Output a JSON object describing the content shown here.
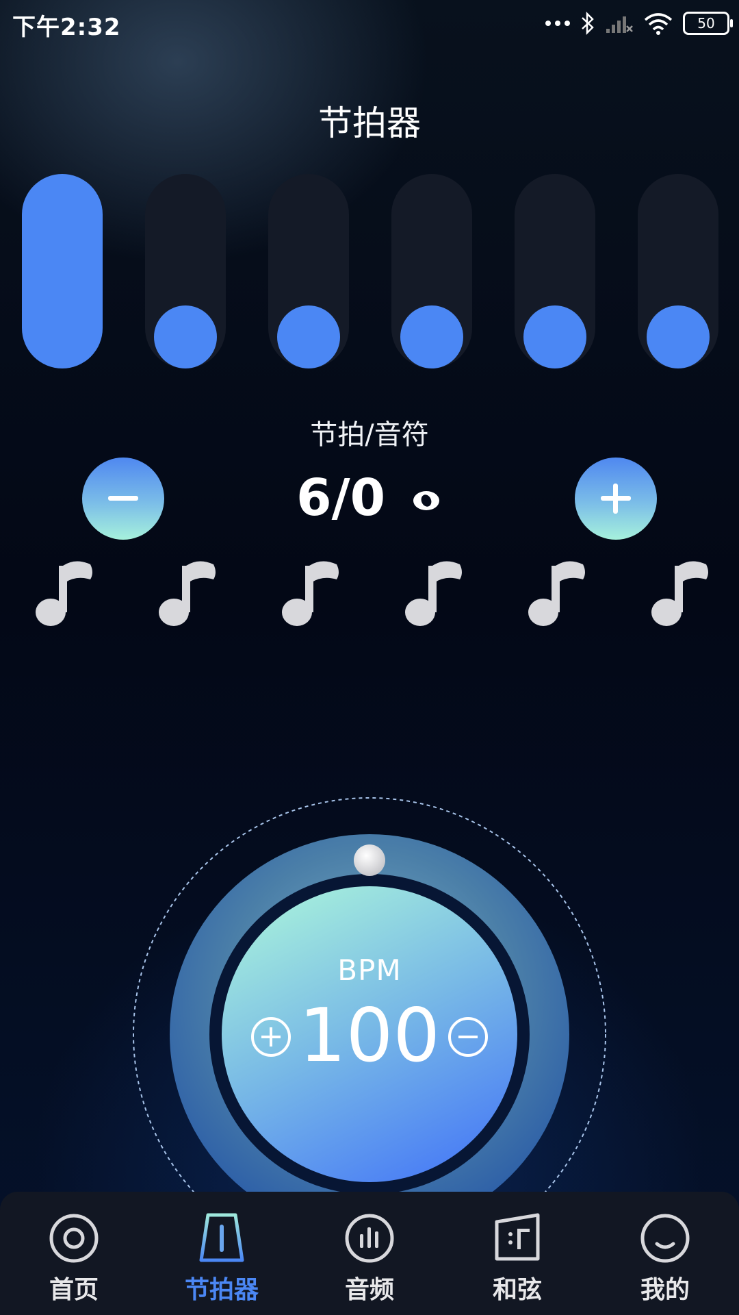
{
  "status_bar": {
    "time": "下午2:32",
    "battery": "50"
  },
  "page": {
    "title": "节拍器"
  },
  "beats": {
    "label": "节拍/音符",
    "signature": "6/0",
    "count": 6,
    "active_index": 0
  },
  "bpm": {
    "label": "BPM",
    "value": "100"
  },
  "nav": {
    "items": [
      {
        "label": "首页",
        "icon": "home-target-icon"
      },
      {
        "label": "节拍器",
        "icon": "metronome-icon",
        "active": true
      },
      {
        "label": "音频",
        "icon": "audio-bars-icon"
      },
      {
        "label": "和弦",
        "icon": "chord-icon"
      },
      {
        "label": "我的",
        "icon": "profile-smile-icon"
      }
    ]
  },
  "colors": {
    "accent": "#4b87f4",
    "bar_inactive": "#141a27",
    "mint": "#a6f1dc"
  }
}
